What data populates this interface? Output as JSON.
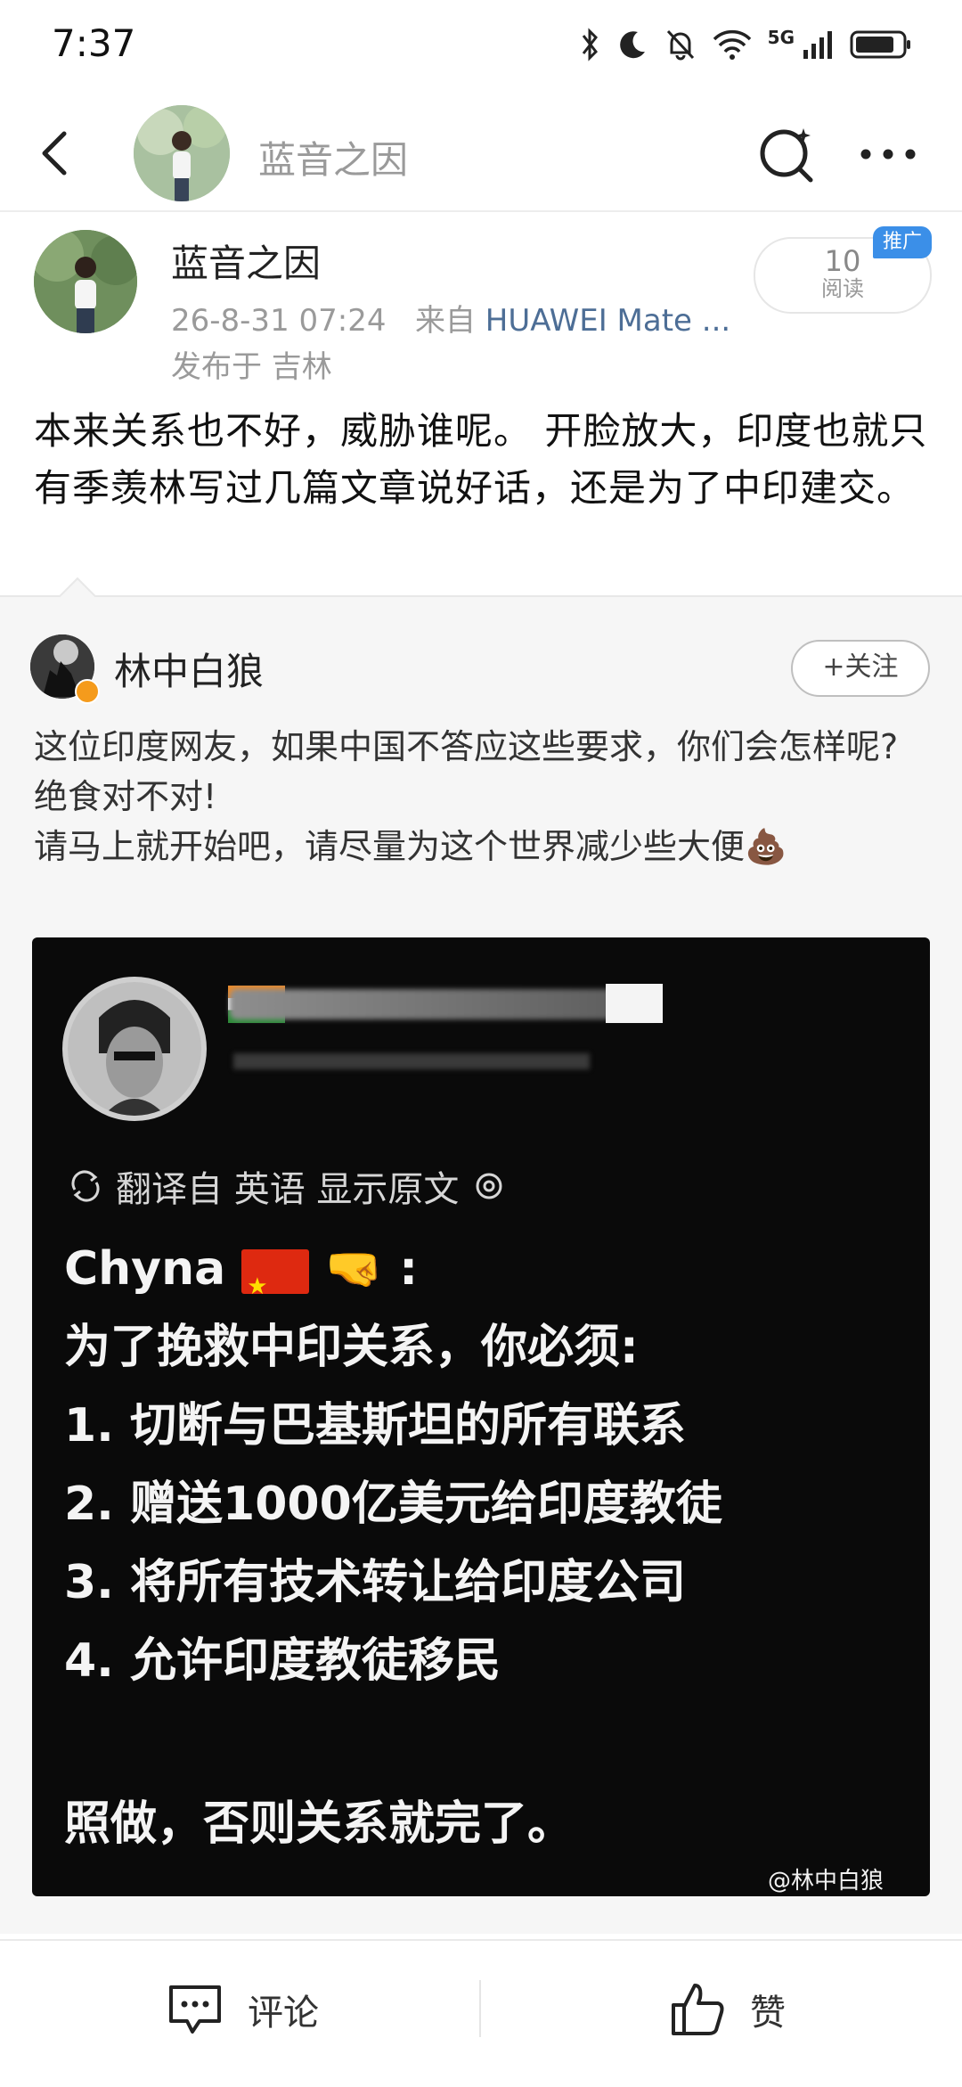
{
  "status_bar": {
    "time": "7:37",
    "network": "5G"
  },
  "nav": {
    "title": "蓝音之因"
  },
  "post": {
    "author": "蓝音之因",
    "date": "26-8-31 07:24",
    "from_label": "来自",
    "device": "HUAWEI Mate ...",
    "location": "发布于 吉林",
    "read_count": "10",
    "read_label": "阅读",
    "promo_label": "推广",
    "text": "本来关系也不好，威胁谁呢。 开脸放大，印度也就只有季羡林写过几篇文章说好话，还是为了中印建交。"
  },
  "repost": {
    "author": "林中白狼",
    "follow_label": "+关注",
    "text_lines": [
      "这位印度网友，如果中国不答应这些要求，你们会怎样呢?",
      "绝食对不对!",
      "请马上就开始吧，请尽量为这个世界减少些大便💩"
    ],
    "image": {
      "translate_label": "翻译自 英语 显示原文",
      "greeting": "Chyna",
      "greeting_suffix": ":",
      "lines": [
        "为了挽救中印关系，你必须:",
        "1. 切断与巴基斯坦的所有联系",
        "2. 赠送1000亿美元给印度教徒",
        "3. 将所有技术转让给印度公司",
        "4. 允许印度教徒移民"
      ],
      "last_line": "照做，否则关系就完了。",
      "watermark": "@林中白狼"
    }
  },
  "actions": {
    "comment_label": "评论",
    "like_label": "赞"
  },
  "colors": {
    "promo": "#3b8fe8",
    "device_link": "#4d6e96",
    "badge": "#f59b1c"
  }
}
